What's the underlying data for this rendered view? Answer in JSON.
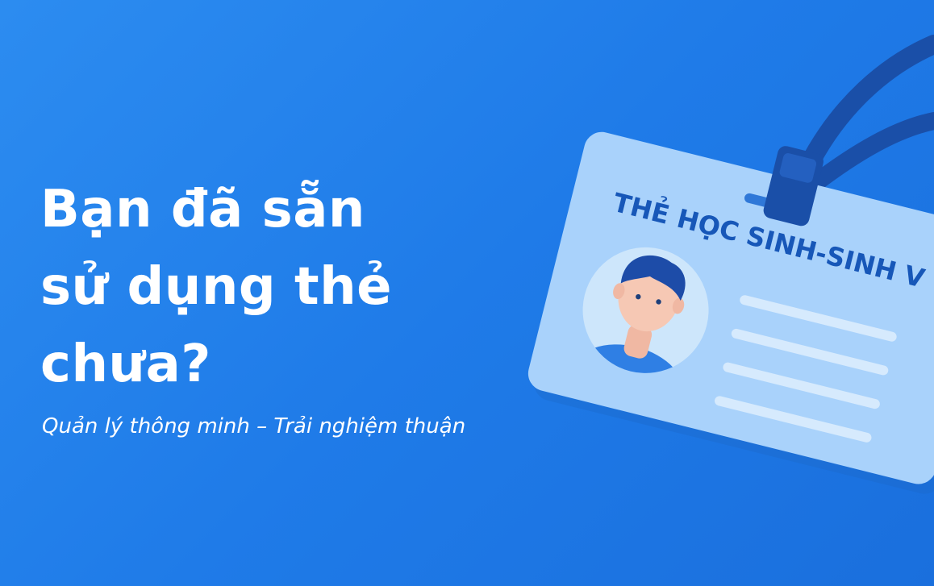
{
  "headline": {
    "line1": "Bạn đã sẵn",
    "line2": "sử dụng thẻ",
    "line3": "chưa?"
  },
  "tagline": "Quản lý thông minh – Trải nghiệm thuận",
  "card": {
    "title": "THẺ HỌC SINH-SINH V"
  },
  "colors": {
    "background": "#1f7be8",
    "card": "#a9d2fb",
    "card_title": "#1757b8",
    "lanyard": "#1a4fa8",
    "avatar_bg": "#cde6fb",
    "shirt": "#2f7fe4",
    "hair": "#1d4ca8",
    "skin": "#f6c8b4",
    "info_lines": "#d6eafd"
  }
}
